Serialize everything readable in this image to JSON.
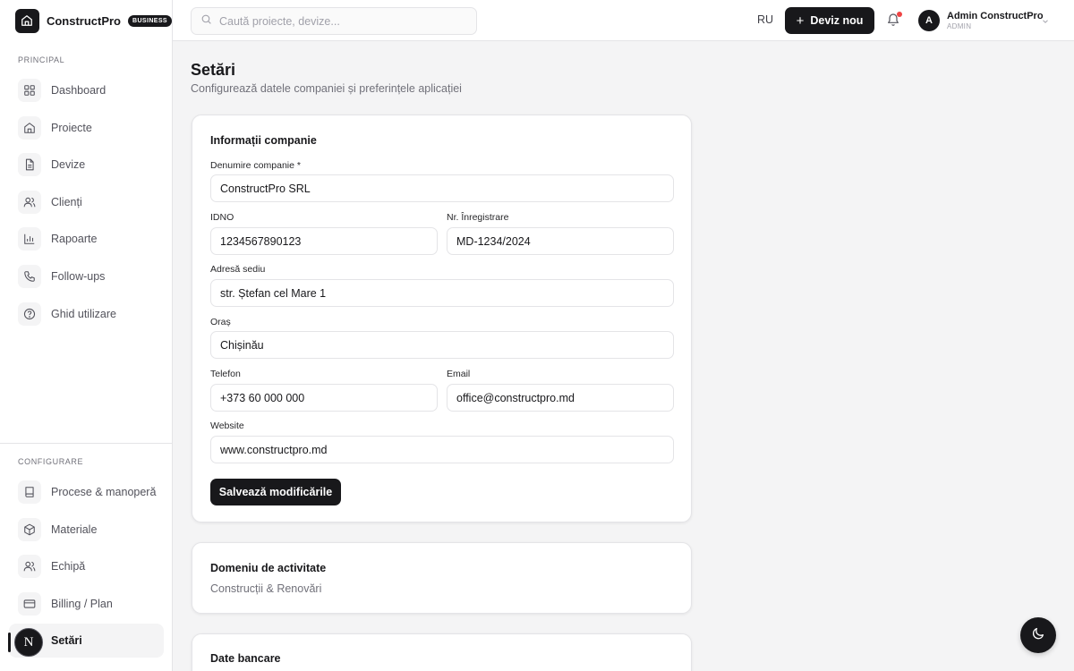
{
  "brand": {
    "name": "ConstructPro",
    "badge": "BUSINESS"
  },
  "sidebar": {
    "principal_label": "PRINCIPAL",
    "principal_items": [
      {
        "label": "Dashboard",
        "icon": "grid-icon"
      },
      {
        "label": "Proiecte",
        "icon": "home-icon"
      },
      {
        "label": "Devize",
        "icon": "document-icon"
      },
      {
        "label": "Clienți",
        "icon": "users-icon"
      },
      {
        "label": "Rapoarte",
        "icon": "bar-chart-icon"
      },
      {
        "label": "Follow-ups",
        "icon": "phone-icon"
      },
      {
        "label": "Ghid utilizare",
        "icon": "help-circle-icon"
      }
    ],
    "config_label": "CONFIGURARE",
    "config_items": [
      {
        "label": "Procese & manoperă",
        "icon": "book-icon"
      },
      {
        "label": "Materiale",
        "icon": "box-icon"
      },
      {
        "label": "Echipă",
        "icon": "team-icon"
      },
      {
        "label": "Billing / Plan",
        "icon": "credit-card-icon"
      },
      {
        "label": "Setări",
        "icon": "settings-icon",
        "active": true
      }
    ]
  },
  "header": {
    "search_placeholder": "Caută proiecte, devize...",
    "language": "RU",
    "new_quote_label": "Deviz nou",
    "user": {
      "initial": "A",
      "name": "Admin ConstructPro",
      "role": "ADMIN"
    }
  },
  "page": {
    "title": "Setări",
    "subtitle": "Configurează datele companiei și preferințele aplicației"
  },
  "company_card": {
    "title": "Informații companie",
    "fields": {
      "company_name": {
        "label": "Denumire companie *",
        "value": "ConstructPro SRL"
      },
      "idno": {
        "label": "IDNO",
        "value": "1234567890123"
      },
      "registration": {
        "label": "Nr. Înregistrare",
        "value": "MD-1234/2024"
      },
      "address": {
        "label": "Adresă sediu",
        "value": "str. Ștefan cel Mare 1"
      },
      "city": {
        "label": "Oraș",
        "value": "Chișinău"
      },
      "phone": {
        "label": "Telefon",
        "value": "+373 60 000 000"
      },
      "email": {
        "label": "Email",
        "value": "office@constructpro.md"
      },
      "website": {
        "label": "Website",
        "value": "www.constructpro.md"
      }
    },
    "save_label": "Salvează modificările"
  },
  "activity_card": {
    "title": "Domeniu de activitate",
    "value": "Construcții & Renovări"
  },
  "bank_card": {
    "title": "Date bancare"
  },
  "floating": {
    "avatar_letter": "N"
  },
  "colors": {
    "primary": "#18181b",
    "background": "#f4f4f5",
    "notification": "#ef4444"
  }
}
